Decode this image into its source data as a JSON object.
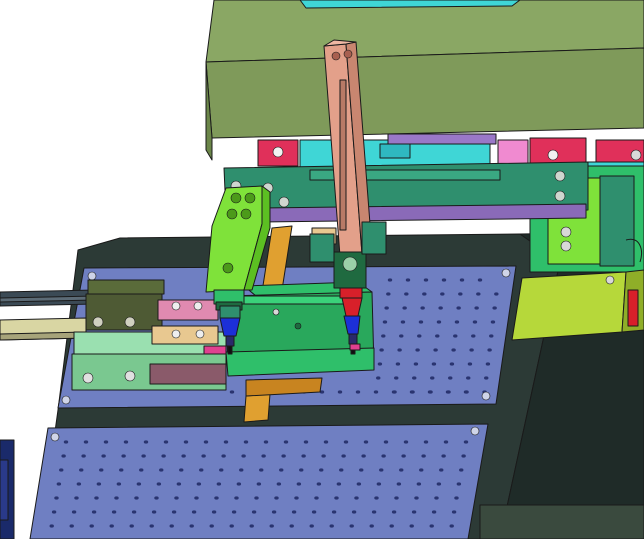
{
  "scene": {
    "kind": "3d-cad-assembly-render",
    "background": "#ffffff",
    "colors": {
      "housing": "#7f9a5a",
      "housing_dark": "#5f7a44",
      "base_plate": "#2c3a36",
      "perforated_plate": "#6f7fc2",
      "perforated_plate_light": "#8b98d6",
      "rail": "#3b4a55",
      "rail_light": "#d9d6a3",
      "carriage": "#2f8f6e",
      "carriage_light": "#7fd07f",
      "slide_green": "#2fbf6a",
      "bright_green": "#7fe23a",
      "lime": "#b6d83a",
      "salmon_column": "#e3a08a",
      "magenta": "#e0305a",
      "cyan": "#3fd6d6",
      "blue_nozzle": "#1c2fd8",
      "red_nozzle": "#d8202a",
      "orange": "#e0a030",
      "purple": "#9a78c8",
      "pink": "#f08ad0",
      "tan": "#e8c890"
    },
    "icons": [
      "screw-head-icon",
      "nozzle-icon",
      "bolt-hole-icon"
    ]
  }
}
